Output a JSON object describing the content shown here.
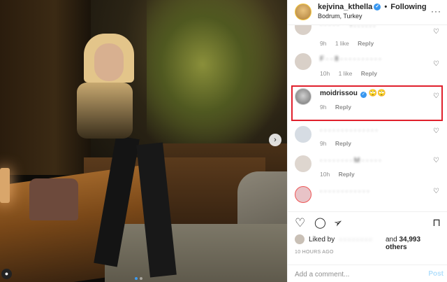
{
  "post": {
    "photo_description_icons": {
      "next": "›",
      "tag": "●"
    },
    "carousel_dots": 2
  },
  "header": {
    "username": "kejvina_kthella",
    "separator": "•",
    "follow_status": "Following",
    "location": "Bodrum, Turkey",
    "more": "···"
  },
  "comments": [
    {
      "text": "· · · · · \" \" ! . . . . . .",
      "time": "9h",
      "likes": "1 like",
      "reply": "Reply"
    },
    {
      "text": "F · · 8 · · · · · · · · · ·",
      "time": "10h",
      "likes": "1 like",
      "reply": "Reply"
    },
    {
      "username": "moidrissou",
      "text": "🙄🙄",
      "time": "9h",
      "reply": "Reply"
    },
    {
      "text": "· · · · · · · · · · · · · ·",
      "time": "9h",
      "reply": "Reply"
    },
    {
      "text": "· · · · · · · · M · · · · ·",
      "time": "10h",
      "reply": "Reply"
    },
    {
      "text": "· · · · · · · · · · · ·"
    }
  ],
  "actions": {
    "like": "♡",
    "comment": "◯",
    "share": "➢",
    "save": "⊓"
  },
  "likes": {
    "liked_by": "Liked by",
    "liker": "· · · · · · · ·",
    "and_others_prefix": "and",
    "others_count": "34,993 others"
  },
  "timestamp": "10 HOURS AGO",
  "add_comment": {
    "placeholder": "Add a comment...",
    "post_label": "Post"
  },
  "colors": {
    "highlight": "#e0202c",
    "verified": "#3897f0",
    "post_disabled": "#b2dffc"
  }
}
